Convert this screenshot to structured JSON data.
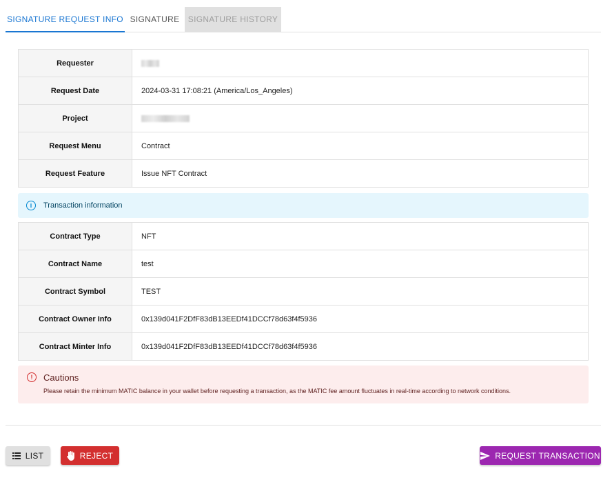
{
  "tabs": [
    {
      "label": "SIGNATURE REQUEST INFO",
      "state": "active"
    },
    {
      "label": "SIGNATURE",
      "state": "normal"
    },
    {
      "label": "SIGNATURE HISTORY",
      "state": "disabled"
    }
  ],
  "request_info": {
    "rows": [
      {
        "label": "Requester",
        "value": ""
      },
      {
        "label": "Request Date",
        "value": "2024-03-31 17:08:21 (America/Los_Angeles)"
      },
      {
        "label": "Project",
        "value": ""
      },
      {
        "label": "Request Menu",
        "value": "Contract"
      },
      {
        "label": "Request Feature",
        "value": "Issue NFT Contract"
      }
    ]
  },
  "transaction_alert": {
    "icon": "info-icon",
    "text": "Transaction information"
  },
  "transaction_info": {
    "rows": [
      {
        "label": "Contract Type",
        "value": "NFT"
      },
      {
        "label": "Contract Name",
        "value": "test"
      },
      {
        "label": "Contract Symbol",
        "value": "TEST"
      },
      {
        "label": "Contract Owner Info",
        "value": "0x139d041F2DfF83dB13EEDf41DCCf78d63f4f5936"
      },
      {
        "label": "Contract Minter Info",
        "value": "0x139d041F2DfF83dB13EEDf41DCCf78d63f4f5936"
      }
    ]
  },
  "cautions": {
    "icon": "error-icon",
    "title": "Cautions",
    "message": "Please retain the minimum MATIC balance in your wallet before requesting a transaction, as the MATIC fee amount fluctuates in real-time according to network conditions."
  },
  "actions": {
    "list_label": "LIST",
    "reject_label": "REJECT",
    "request_label": "REQUEST TRANSACTION"
  },
  "colors": {
    "tab_active": "#1976d2",
    "reject": "#d32f2f",
    "request": "#9c27b0",
    "info_bg": "#e5f6fd",
    "error_bg": "#fdeded"
  }
}
